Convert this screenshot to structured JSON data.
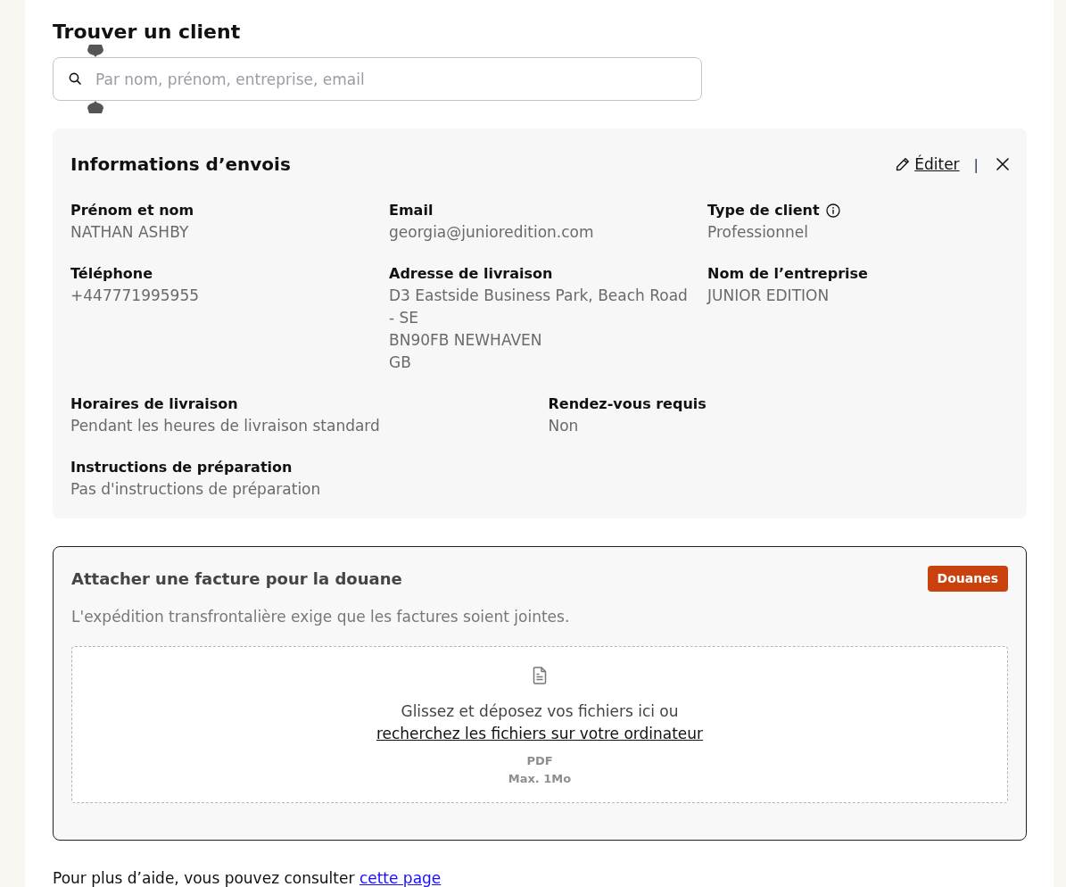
{
  "search_section": {
    "title": "Trouver un client",
    "search": {
      "placeholder": "Par nom, prénom, entreprise, email"
    }
  },
  "shipping_info": {
    "title": "Informations d’envois",
    "edit_link": "Éditer",
    "separator": "|",
    "rows": [
      {
        "fields": [
          {
            "label": "Prénom et nom",
            "info_icon": false,
            "values": [
              "NATHAN ASHBY"
            ]
          },
          {
            "label": "Email",
            "info_icon": false,
            "values": [
              "georgia@junioredition.com"
            ]
          },
          {
            "label": "Type de client",
            "info_icon": true,
            "values": [
              "Professionnel"
            ]
          }
        ]
      },
      {
        "fields": [
          {
            "label": "Téléphone",
            "info_icon": false,
            "values": [
              "+447771995955"
            ]
          },
          {
            "label": "Adresse de livraison",
            "info_icon": false,
            "values": [
              "D3 Eastside Business Park, Beach Road - SE",
              "BN90FB NEWHAVEN",
              "GB"
            ]
          },
          {
            "label": "Nom de l’entreprise",
            "info_icon": false,
            "values": [
              "JUNIOR EDITION"
            ]
          }
        ]
      },
      {
        "fields": [
          {
            "label": "Horaires de livraison",
            "info_icon": false,
            "values": [
              "Pendant les heures de livraison standard"
            ]
          },
          {
            "label": "Rendez-vous requis",
            "info_icon": false,
            "values": [
              "Non"
            ]
          }
        ]
      },
      {
        "fields": [
          {
            "label": "Instructions de préparation",
            "info_icon": false,
            "values": [
              "Pas d'instructions de préparation"
            ]
          }
        ]
      }
    ]
  },
  "customs": {
    "title": "Attacher une facture pour la douane",
    "badge": "Douanes",
    "description": "L'expédition transfrontalière exige que les factures soient jointes.",
    "dropzone": {
      "prompt": "Glissez et déposez vos fichiers ici ou",
      "browse_link": "recherchez les fichiers sur votre ordinateur",
      "formats": "PDF",
      "max_size": "Max. 1Mo"
    }
  },
  "help": {
    "text": "Pour plus d’aide, vous pouvez consulter",
    "link": "cette page"
  }
}
